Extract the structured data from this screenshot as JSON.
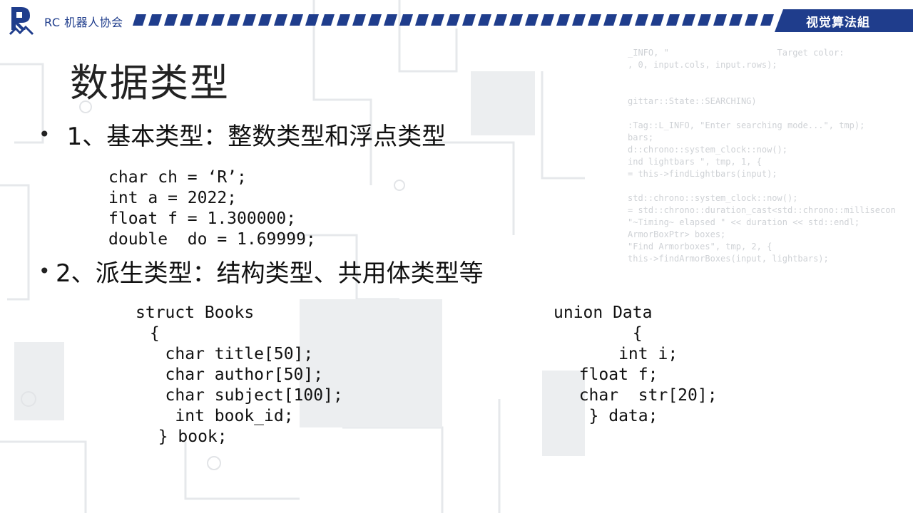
{
  "header": {
    "brand": "RC 机器人协会",
    "tag": "视觉算法組",
    "accent_color": "#1f3d8c"
  },
  "title": "数据类型",
  "sections": [
    {
      "bullet": "•",
      "heading": "  1、基本类型：整数类型和浮点类型",
      "code": [
        "char ch = ‘R’;",
        "int a = 2022;",
        "float f = 1.300000;",
        "double  do = 1.69999;"
      ]
    },
    {
      "bullet": "•",
      "heading": "2、派生类型：结构类型、共用体类型等",
      "struct_code": [
        "struct Books",
        " {",
        "   char title[50];",
        "   char author[50];",
        "   char subject[100];",
        "    int book_id;",
        "  } book;"
      ],
      "union_code": [
        "union Data",
        "        {",
        "      int i;",
        "  float f;",
        "  char  str[20];",
        "   } data;"
      ]
    }
  ]
}
